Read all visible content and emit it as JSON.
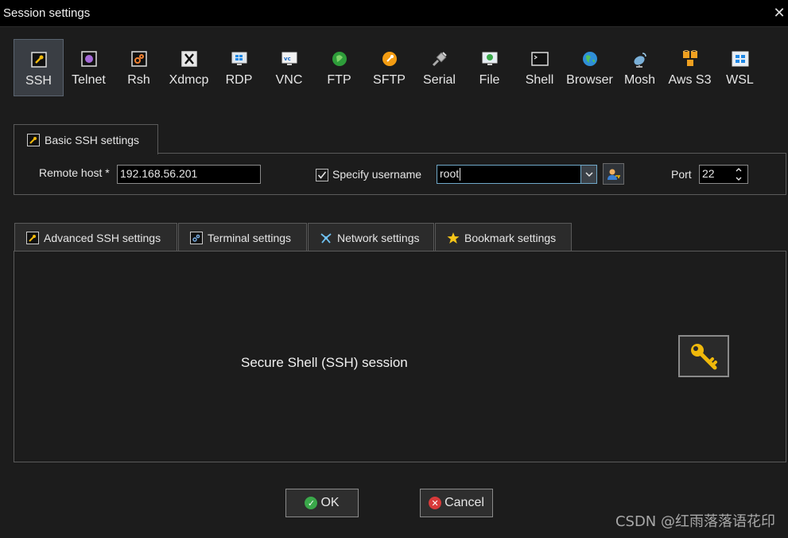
{
  "window": {
    "title": "Session settings",
    "close_symbol": "✕"
  },
  "session_types": [
    {
      "label": "SSH",
      "icon": "ssh-icon",
      "active": true
    },
    {
      "label": "Telnet",
      "icon": "telnet-icon"
    },
    {
      "label": "Rsh",
      "icon": "rsh-icon"
    },
    {
      "label": "Xdmcp",
      "icon": "xdmcp-icon"
    },
    {
      "label": "RDP",
      "icon": "rdp-icon"
    },
    {
      "label": "VNC",
      "icon": "vnc-icon"
    },
    {
      "label": "FTP",
      "icon": "ftp-icon"
    },
    {
      "label": "SFTP",
      "icon": "sftp-icon"
    },
    {
      "label": "Serial",
      "icon": "serial-icon"
    },
    {
      "label": "File",
      "icon": "file-icon"
    },
    {
      "label": "Shell",
      "icon": "shell-icon"
    },
    {
      "label": "Browser",
      "icon": "browser-icon"
    },
    {
      "label": "Mosh",
      "icon": "mosh-icon"
    },
    {
      "label": "Aws S3",
      "icon": "aws-s3-icon"
    },
    {
      "label": "WSL",
      "icon": "wsl-icon"
    }
  ],
  "basic": {
    "tab_label": "Basic SSH settings",
    "remote_host_label": "Remote host *",
    "remote_host_value": "192.168.56.201",
    "specify_username_label": "Specify username",
    "specify_username_checked": true,
    "username_value": "root",
    "port_label": "Port",
    "port_value": "22"
  },
  "tabs": [
    {
      "label": "Advanced SSH settings",
      "icon": "wrench-icon"
    },
    {
      "label": "Terminal settings",
      "icon": "terminal-icon"
    },
    {
      "label": "Network settings",
      "icon": "network-icon"
    },
    {
      "label": "Bookmark settings",
      "icon": "star-icon"
    }
  ],
  "content": {
    "description": "Secure Shell (SSH) session"
  },
  "buttons": {
    "ok_label": "OK",
    "cancel_label": "Cancel"
  },
  "watermark": "CSDN @红雨落落语花印",
  "colors": {
    "accent_border": "#6fa8c8",
    "ok_green": "#3aa84a",
    "cancel_red": "#d83a3a",
    "key_gold": "#f0b90b"
  }
}
